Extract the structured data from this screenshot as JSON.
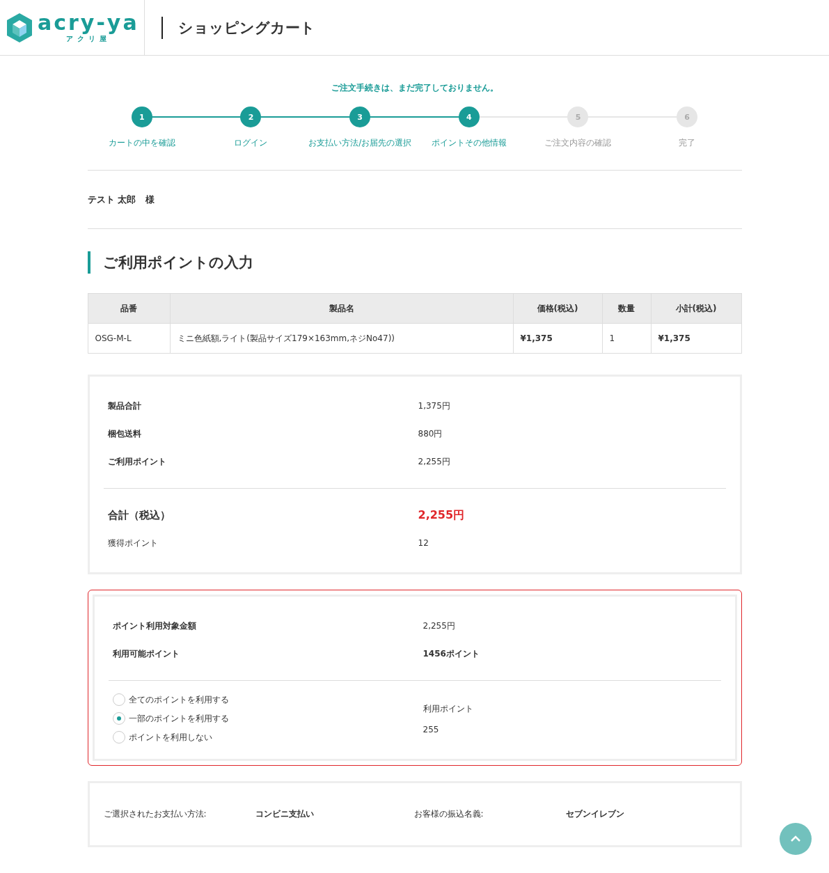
{
  "header": {
    "logo_text": "acry-ya",
    "logo_sub": "アクリ屋",
    "title": "ショッピングカート"
  },
  "notice": "ご注文手続きは、まだ完了しておりません。",
  "steps": [
    {
      "number": "1",
      "label": "カートの中を確認",
      "completed": true
    },
    {
      "number": "2",
      "label": "ログイン",
      "completed": true
    },
    {
      "number": "3",
      "label": "お支払い方法/お届先の選択",
      "completed": true
    },
    {
      "number": "4",
      "label": "ポイントその他情報",
      "completed": true
    },
    {
      "number": "5",
      "label": "ご注文内容の確認",
      "completed": false
    },
    {
      "number": "6",
      "label": "完了",
      "completed": false
    }
  ],
  "customer": {
    "name": "テスト 太郎",
    "honorific": "様"
  },
  "section_title": "ご利用ポイントの入力",
  "table": {
    "columns": [
      "品番",
      "製品名",
      "価格(税込)",
      "数量",
      "小計(税込)"
    ],
    "rows": [
      [
        "OSG-M-L",
        "ミニ色紙額,ライト(製品サイズ179×163mm,ネジNo47))",
        "¥1,375",
        "1",
        "¥1,375"
      ]
    ]
  },
  "summary": {
    "lines": [
      {
        "label": "製品合計",
        "value": "1,375円"
      },
      {
        "label": "梱包送料",
        "value": "880円"
      },
      {
        "label": "ご利用ポイント",
        "value": "2,255円"
      }
    ],
    "total_label": "合計（税込）",
    "total_value": "2,255円",
    "earned_label": "獲得ポイント",
    "earned_value": "12"
  },
  "points": {
    "lines": [
      {
        "label": "ポイント利用対象金額",
        "value": "2,255円"
      },
      {
        "label": "利用可能ポイント",
        "value": "1456ポイント"
      }
    ],
    "options": [
      {
        "label": "全てのポイントを利用する",
        "selected": false
      },
      {
        "label": "一部のポイントを利用する",
        "selected": true
      },
      {
        "label": "ポイントを利用しない",
        "selected": false
      }
    ],
    "use_label": "利用ポイント",
    "use_value": "255"
  },
  "payment": {
    "method_label": "ご選択されたお支払い方法:",
    "method_value": "コンビニ支払い",
    "name_label": "お客様の振込名義:",
    "name_value": "セブンイレブン"
  }
}
